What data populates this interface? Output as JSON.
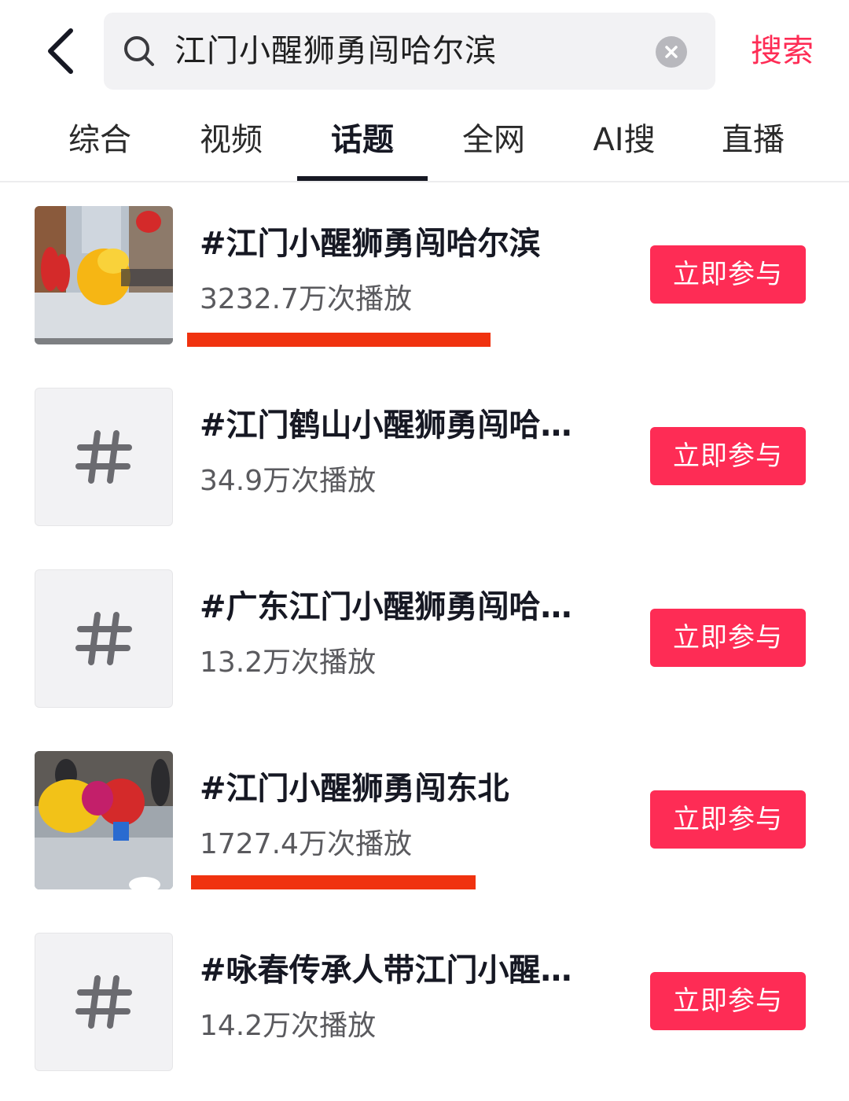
{
  "header": {
    "query": "江门小醒狮勇闯哈尔滨",
    "search_button": "搜索"
  },
  "tabs": [
    {
      "label": "综合",
      "active": false
    },
    {
      "label": "视频",
      "active": false
    },
    {
      "label": "话题",
      "active": true
    },
    {
      "label": "全网",
      "active": false
    },
    {
      "label": "AI搜",
      "active": false
    },
    {
      "label": "直播",
      "active": false
    }
  ],
  "results": [
    {
      "title": "#江门小醒狮勇闯哈尔滨",
      "views": "3232.7万次播放",
      "thumbnail": "lion-dance-photo",
      "join": "立即参与",
      "highlighted": true
    },
    {
      "title": "#江门鹤山小醒狮勇闯哈…",
      "views": "34.9万次播放",
      "thumbnail": "hash-icon",
      "join": "立即参与",
      "highlighted": false
    },
    {
      "title": "#广东江门小醒狮勇闯哈…",
      "views": "13.2万次播放",
      "thumbnail": "hash-icon",
      "join": "立即参与",
      "highlighted": false
    },
    {
      "title": "#江门小醒狮勇闯东北",
      "views": "1727.4万次播放",
      "thumbnail": "lion-dance-photo",
      "join": "立即参与",
      "highlighted": true
    },
    {
      "title": "#咏春传承人带江门小醒…",
      "views": "14.2万次播放",
      "thumbnail": "hash-icon",
      "join": "立即参与",
      "highlighted": false
    }
  ],
  "colors": {
    "accent": "#fe2c55",
    "highlight_underline": "#f0320f",
    "text_primary": "#161823",
    "text_secondary": "#5a5a5e",
    "search_bg": "#f2f2f4"
  }
}
